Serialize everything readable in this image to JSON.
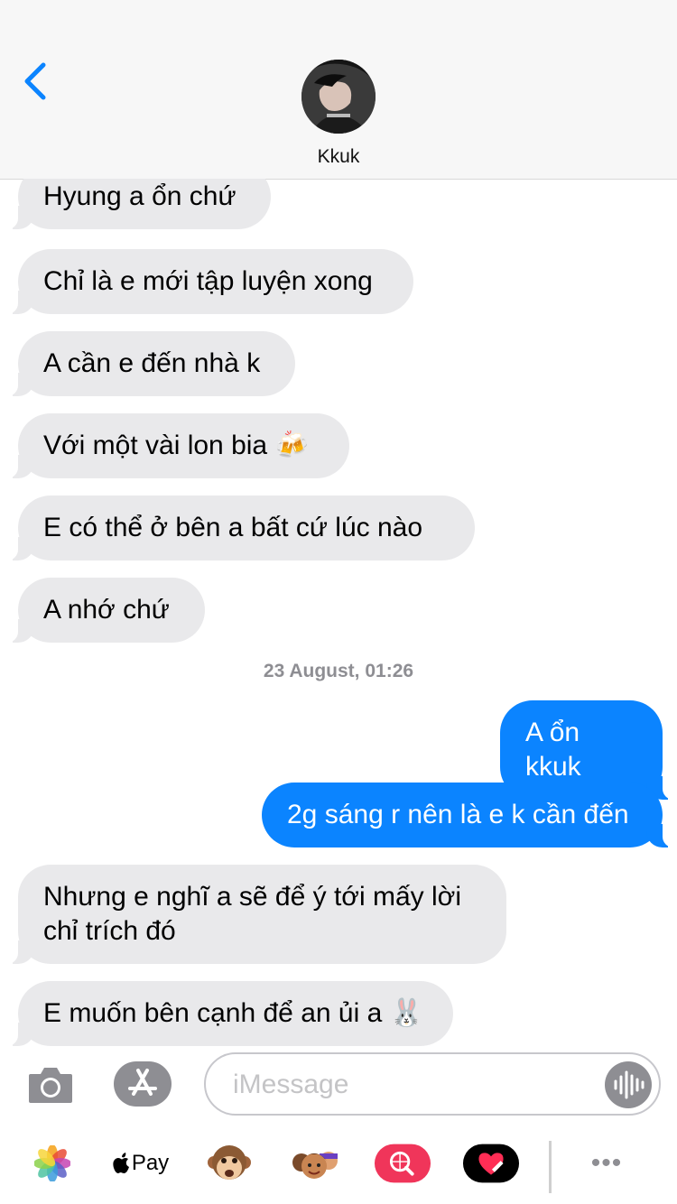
{
  "contact": {
    "name": "Kkuk"
  },
  "messages": [
    {
      "direction": "in",
      "text": "Hyung a ổn chứ"
    },
    {
      "direction": "in",
      "text": "Chỉ là e mới tập luyện xong"
    },
    {
      "direction": "in",
      "text": "A cần e đến nhà k"
    },
    {
      "direction": "in",
      "text": "Với một vài lon bia 🍻"
    },
    {
      "direction": "in",
      "text": "E có thể ở bên a bất cứ lúc nào"
    },
    {
      "direction": "in",
      "text": "A nhớ chứ"
    },
    {
      "direction": "out",
      "text": "A ổn kkuk"
    },
    {
      "direction": "out",
      "text": "2g sáng r nên là e k cần đến"
    },
    {
      "direction": "in",
      "text": "Nhưng e nghĩ a sẽ để ý tới mấy lời chỉ trích đó"
    },
    {
      "direction": "in",
      "text": "E muốn bên cạnh để an ủi a 🐰"
    }
  ],
  "timestamp": {
    "date": "23 August,",
    "time": "01:26"
  },
  "composer": {
    "placeholder": "iMessage"
  },
  "app_drawer": {
    "pay_label": "Pay",
    "more_label": "•••",
    "icons": [
      "photos-icon",
      "apple-pay-icon",
      "animoji-icon",
      "memoji-icon",
      "images-search-icon",
      "digital-touch-icon",
      "more-icon"
    ]
  },
  "colors": {
    "outgoing_bubble": "#0b84ff",
    "incoming_bubble": "#e9e9eb",
    "accent": "#0b84ff",
    "battery": "#4cd964"
  }
}
